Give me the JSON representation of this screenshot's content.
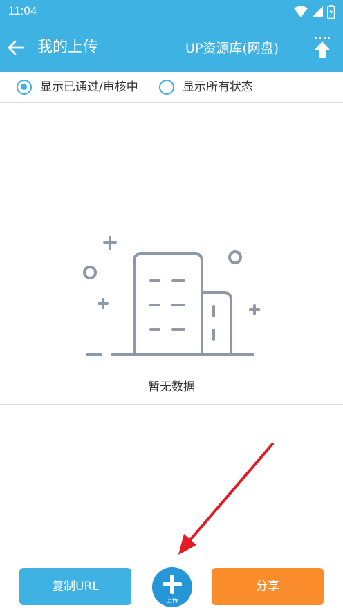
{
  "status_bar": {
    "time": "11:04"
  },
  "app_bar": {
    "title": "我的上传",
    "right_title": "UP资源库(网盘)"
  },
  "filter": {
    "option_passed": "显示已通过/审核中",
    "option_all": "显示所有状态",
    "selected": "option_passed"
  },
  "empty_state": {
    "message": "暂无数据"
  },
  "bottom_bar": {
    "copy_url_label": "复制URL",
    "upload_label": "上传",
    "share_label": "分享"
  },
  "colors": {
    "primary": "#3db2e3",
    "fab": "#2696d6",
    "share": "#fb8c2b",
    "annotation_arrow": "#e31b23",
    "illustration": "#8e98a8"
  },
  "icons": [
    "wifi-icon",
    "signal-icon",
    "battery-icon",
    "back-arrow-icon",
    "upload-icon",
    "empty-building-icon",
    "plus-icon",
    "annotation-arrow"
  ]
}
